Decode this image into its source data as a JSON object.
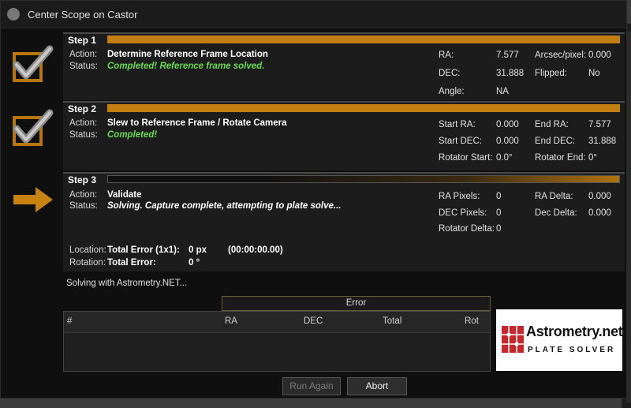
{
  "window": {
    "title": "Center Scope on Castor"
  },
  "icons": {
    "app": "app-icon",
    "done": "checkmark-icon",
    "current": "arrow-right-icon"
  },
  "colors": {
    "accent": "#c27e10",
    "completed": "#6bdc55"
  },
  "labels": {
    "action": "Action:",
    "status": "Status:"
  },
  "steps": [
    {
      "title": "Step 1",
      "progress": 1.0,
      "action": "Determine Reference Frame Location",
      "status": "Completed!  Reference frame solved.",
      "stats": [
        {
          "label": "RA:",
          "value": "7.577"
        },
        {
          "label": "Arcsec/pixel:",
          "value": "0.000"
        },
        {
          "label": "DEC:",
          "value": "31.888"
        },
        {
          "label": "Flipped:",
          "value": "No"
        },
        {
          "label": "Angle:",
          "value": "NA"
        }
      ]
    },
    {
      "title": "Step 2",
      "progress": 1.0,
      "action": "Slew to Reference Frame / Rotate Camera",
      "status": "Completed!",
      "stats": [
        {
          "label": "Start RA:",
          "value": "0.000"
        },
        {
          "label": "End RA:",
          "value": "7.577"
        },
        {
          "label": "Start DEC:",
          "value": "0.000"
        },
        {
          "label": "End DEC:",
          "value": "31.888"
        },
        {
          "label": "Rotator Start:",
          "value": "0.0°"
        },
        {
          "label": "Rotator End:",
          "value": "0°"
        }
      ]
    },
    {
      "title": "Step 3",
      "action": "Validate",
      "status": "Solving.  Capture complete, attempting to plate solve...",
      "stats": [
        {
          "label": "RA Pixels:",
          "value": "0"
        },
        {
          "label": "RA Delta:",
          "value": "0.000"
        },
        {
          "label": "DEC Pixels:",
          "value": "0"
        },
        {
          "label": "Dec Delta:",
          "value": "0.000"
        },
        {
          "label": "Rotator Delta:",
          "value": "0"
        }
      ],
      "location_label": "Location:",
      "location_title": "Total Error (1x1):",
      "location_value": "0 px",
      "location_time": "(00:00:00.00)",
      "rotation_label": "Rotation:",
      "rotation_title": "Total Error:",
      "rotation_value": "0 °"
    }
  ],
  "solving_text": "Solving with Astrometry.NET...",
  "error_table": {
    "group_header": "Error",
    "columns": [
      "#",
      "RA",
      "DEC",
      "Total",
      "Rot"
    ]
  },
  "logo": {
    "name": "Astrometry.net",
    "subtitle": "PLATE SOLVER"
  },
  "buttons": {
    "run_again": "Run Again",
    "abort": "Abort"
  }
}
